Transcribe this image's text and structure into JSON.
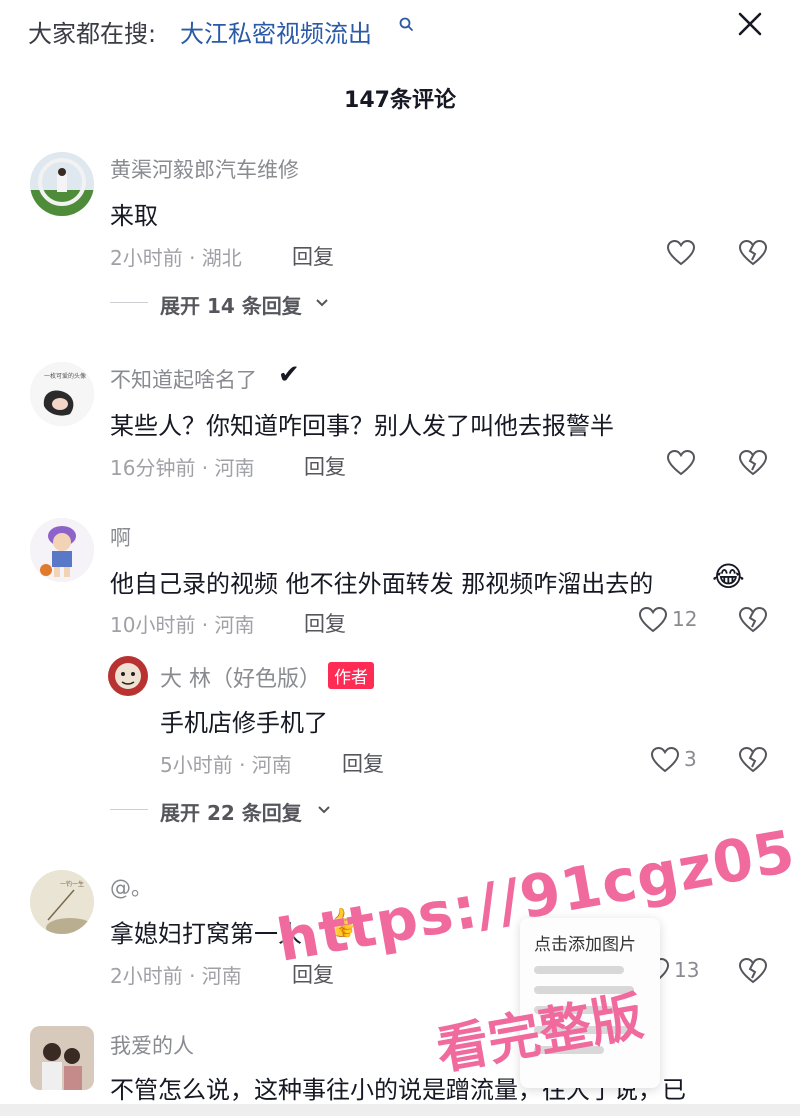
{
  "header": {
    "search_prefix": "大家都在搜:",
    "search_query": "大江私密视频流出",
    "comment_count_title": "147条评论"
  },
  "comments": [
    {
      "username": "黄渠河毅郎汽车维修",
      "content": "来取",
      "meta": "2小时前 · 湖北",
      "reply_label": "回复",
      "like_count": "",
      "expand_label": "展开 14 条回复"
    },
    {
      "username": "不知道起啥名了",
      "username_suffix": "✔",
      "content": "某些人？你知道咋回事？别人发了叫他去报警半",
      "meta": "16分钟前 · 河南",
      "reply_label": "回复",
      "like_count": ""
    },
    {
      "username": "啊",
      "content": "他自己录的视频 他不往外面转发 那视频咋溜出去的",
      "emoji": "😂",
      "meta": "10小时前 · 河南",
      "reply_label": "回复",
      "like_count": "12",
      "reply": {
        "username": "大 林（好色版）",
        "badge": "作者",
        "content": "手机店修手机了",
        "meta": "5小时前 · 河南",
        "reply_label": "回复",
        "like_count": "3"
      },
      "expand_label": "展开 22 条回复"
    },
    {
      "username": "@。",
      "content": "拿媳妇打窝第一人",
      "emoji": "👍",
      "meta": "2小时前 · 河南",
      "reply_label": "回复",
      "like_count": "13"
    },
    {
      "username": "我爱的人",
      "content": "不管怎么说，这种事往小的说是蹭流量，往大了说，已"
    }
  ],
  "popup": {
    "title": "点击添加图片"
  },
  "watermark": {
    "url": "https://91cgz05.com",
    "text": "看完整版"
  },
  "colors": {
    "link": "#2b5aa6",
    "badge": "#fe2c55",
    "watermark": "#f06a9e"
  }
}
